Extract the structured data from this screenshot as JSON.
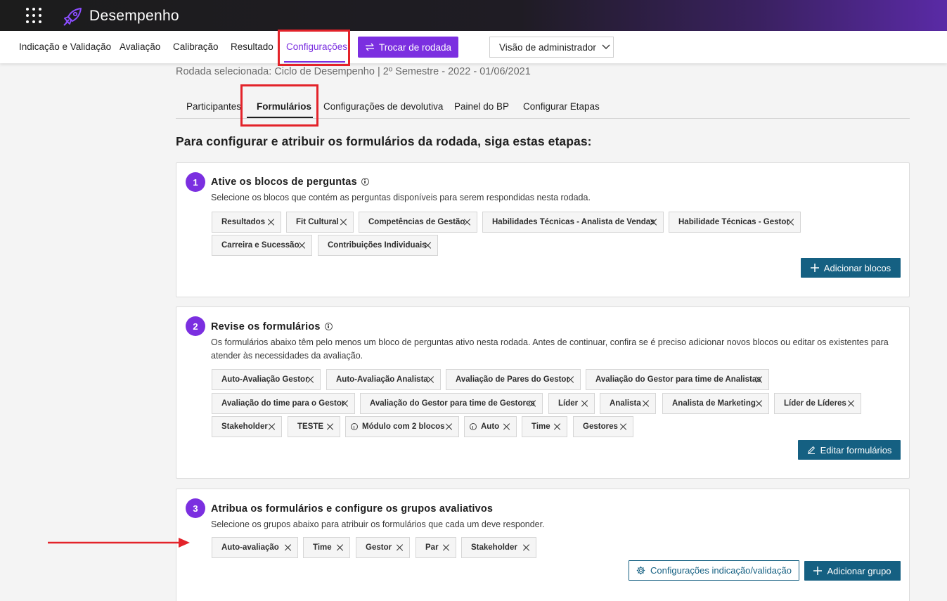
{
  "app": {
    "title": "Desempenho"
  },
  "icons": {
    "apps": "apps-grid-icon",
    "logo": "rocket-logo-icon",
    "switch": "swap-arrows-icon",
    "chevron": "chevron-down-icon",
    "plus": "plus-icon",
    "edit": "pencil-icon",
    "settings": "gear-icon",
    "close": "close-icon",
    "info": "info-icon"
  },
  "colors": {
    "accent": "#7b2fe0",
    "primary_button": "#156082",
    "highlight": "#e3232a"
  },
  "nav": {
    "items": [
      {
        "label": "Indicação e Validação"
      },
      {
        "label": "Avaliação"
      },
      {
        "label": "Calibração"
      },
      {
        "label": "Resultado"
      },
      {
        "label": "Configurações"
      }
    ],
    "switch_button": "Trocar de rodada",
    "admin_select": "Visão de administrador"
  },
  "round_info": "Rodada selecionada: Ciclo de Desempenho | 2º Semestre - 2022 - 01/06/2021",
  "subtabs": [
    {
      "label": "Participantes"
    },
    {
      "label": "Formulários"
    },
    {
      "label": "Configurações de devolutiva"
    },
    {
      "label": "Painel do BP"
    },
    {
      "label": "Configurar Etapas"
    }
  ],
  "heading": "Para configurar e atribuir os formulários da rodada, siga estas etapas:",
  "step1": {
    "number": "1",
    "title": "Ative os blocos de perguntas",
    "description": "Selecione os blocos que contém as perguntas disponíveis para serem respondidas nesta rodada.",
    "chips": [
      "Resultados",
      "Fit Cultural",
      "Competências de Gestão",
      "Habilidades Técnicas - Analista de Vendas",
      "Habilidade Técnicas - Gestor",
      "Carreira e Sucessão",
      "Contribuições Individuais"
    ],
    "button": "Adicionar blocos"
  },
  "step2": {
    "number": "2",
    "title": "Revise os formulários",
    "description": "Os formulários abaixo têm pelo menos um bloco de perguntas ativo nesta rodada. Antes de continuar, confira se é preciso adicionar novos blocos ou editar os existentes para atender às necessidades da avaliação.",
    "chips": [
      "Auto-Avaliação Gestor",
      "Auto-Avaliação Analista",
      "Avaliação de Pares do Gestor",
      "Avaliação do Gestor para time de Analistas",
      "Avaliação do time para o Gestor",
      "Avaliação do Gestor para time de Gestores",
      "Líder",
      "Analista",
      "Analista de Marketing",
      "Líder de Líderes",
      "Stakeholder",
      "TESTE",
      "Módulo com 2 blocos",
      "Auto",
      "Time",
      "Gestores"
    ],
    "button": "Editar formulários"
  },
  "step3": {
    "number": "3",
    "title": "Atribua os formulários e configure os grupos avaliativos",
    "description": "Selecione os grupos abaixo para atribuir os formulários que cada um deve responder.",
    "chips": [
      "Auto-avaliação",
      "Time",
      "Gestor",
      "Par",
      "Stakeholder"
    ],
    "button_settings": "Configurações indicação/validação",
    "button_add": "Adicionar grupo"
  }
}
